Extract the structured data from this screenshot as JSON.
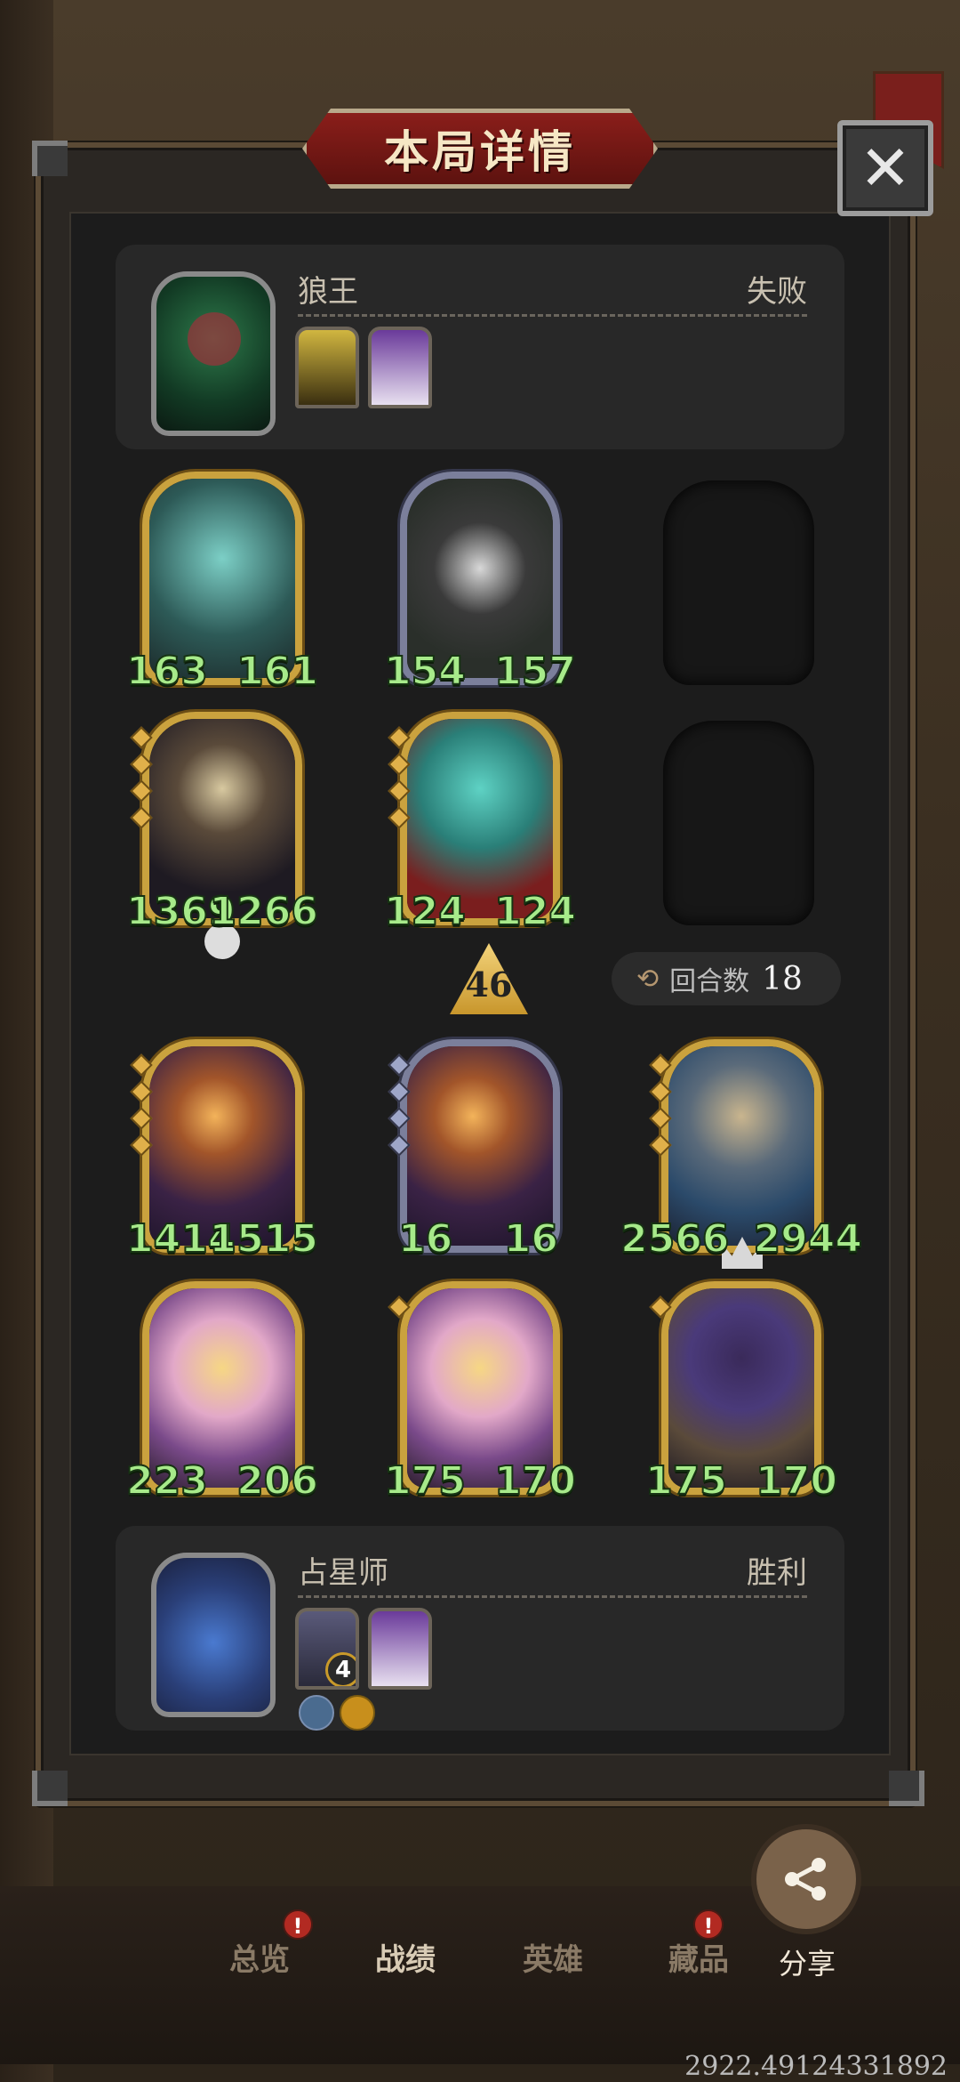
{
  "title": "本局详情",
  "close_icon": "close-icon",
  "opponent": {
    "name": "狼王",
    "result": "失败"
  },
  "opponent_board": {
    "row1": [
      {
        "atk": "163",
        "hp": "161",
        "frame": "gold"
      },
      {
        "atk": "154",
        "hp": "157",
        "frame": "silver"
      }
    ],
    "row2": [
      {
        "atk": "1369",
        "hp": "1266",
        "frame": "gold"
      },
      {
        "atk": "124",
        "hp": "124",
        "frame": "gold"
      }
    ]
  },
  "level": "46",
  "rounds": {
    "label": "回合数",
    "value": "18"
  },
  "player_board": {
    "row1": [
      {
        "atk": "1414",
        "hp": "1515",
        "frame": "gold"
      },
      {
        "atk": "16",
        "hp": "16",
        "frame": "silver"
      },
      {
        "atk": "2566",
        "hp": "2944",
        "frame": "gold"
      }
    ],
    "row2": [
      {
        "atk": "223",
        "hp": "206",
        "frame": "gold"
      },
      {
        "atk": "175",
        "hp": "170",
        "frame": "gold"
      },
      {
        "atk": "175",
        "hp": "170",
        "frame": "gold"
      }
    ]
  },
  "player": {
    "name": "占星师",
    "result": "胜利",
    "badge": "4"
  },
  "tabs": [
    {
      "label": "总览",
      "badge": "!"
    },
    {
      "label": "战绩",
      "badge": ""
    },
    {
      "label": "英雄",
      "badge": ""
    },
    {
      "label": "藏品",
      "badge": "!"
    }
  ],
  "share": {
    "label": "分享"
  },
  "footer_numbers": "2922.49124331892",
  "colors": {
    "stat_green": "#a7ea8a",
    "gold_frame": "#caa23e",
    "title_red": "#8a1e1a"
  }
}
